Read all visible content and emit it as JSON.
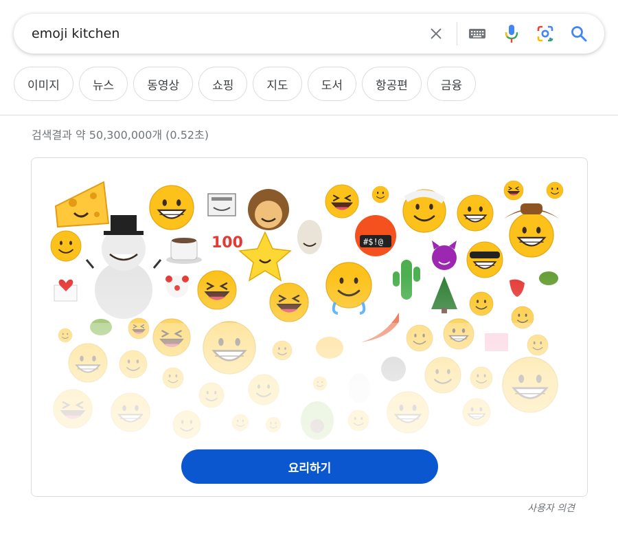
{
  "search": {
    "query": "emoji kitchen",
    "clear_icon": "close-icon",
    "keyboard_icon": "keyboard-icon",
    "voice_icon": "microphone-icon",
    "lens_icon": "lens-camera-icon",
    "search_icon": "search-icon"
  },
  "chips": [
    {
      "label": "이미지"
    },
    {
      "label": "뉴스"
    },
    {
      "label": "동영상"
    },
    {
      "label": "쇼핑"
    },
    {
      "label": "지도"
    },
    {
      "label": "도서"
    },
    {
      "label": "항공편"
    },
    {
      "label": "금융"
    }
  ],
  "result_stats": "검색결과 약 50,300,000개 (0.52초)",
  "emoji_kitchen": {
    "button_label": "요리하기",
    "feedback_label": "사용자 의견"
  },
  "colors": {
    "accent_blue": "#0b57d0",
    "google_blue": "#4285f4",
    "google_red": "#ea4335",
    "google_yellow": "#fbbc04",
    "google_green": "#34a853"
  }
}
